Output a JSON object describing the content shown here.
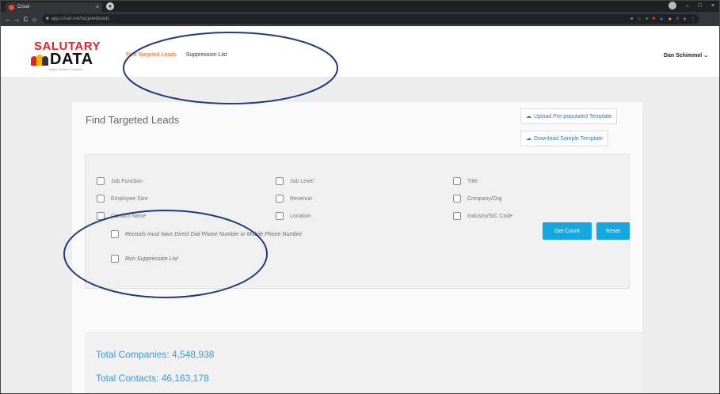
{
  "browser": {
    "tab_title": "Crisel",
    "tab_close": "×",
    "new_tab": "+",
    "url": "app.crisel.net/targetedleads",
    "window_controls": [
      "–",
      "□",
      "×"
    ]
  },
  "header": {
    "logo_top": "SALUTARY",
    "logo_bottom": "DATA",
    "logo_tagline": "Highly Curated Contacts",
    "nav": [
      {
        "label": "Find Targeted Leads",
        "active": true
      },
      {
        "label": "Suppression List",
        "active": false
      }
    ],
    "user_name": "Dan Schimmel",
    "user_caret": "⌄"
  },
  "main": {
    "title": "Find Targeted Leads",
    "upload_template": "Upload Pre-populated Template",
    "download_template": "Download Sample Template",
    "filters": {
      "col1": [
        "Job Function",
        "Employee Size",
        "Contact Name"
      ],
      "col2": [
        "Job Level",
        "Revenue",
        "Location"
      ],
      "col3": [
        "Title",
        "Company/Org",
        "Industry/SIC Code"
      ]
    },
    "options": [
      "Records must have Direct Dial Phone Number or Mobile Phone Number",
      "Run Suppression List"
    ],
    "get_count": "Get Count",
    "reset": "Reset",
    "total_companies": "Total Companies: 4,548,938",
    "total_contacts": "Total Contacts: 46,163,178"
  },
  "colors": {
    "accent": "#17a7e0",
    "nav_active": "#f26522",
    "logo_red": "#e2232a",
    "annotation": "#1f3b7a"
  }
}
